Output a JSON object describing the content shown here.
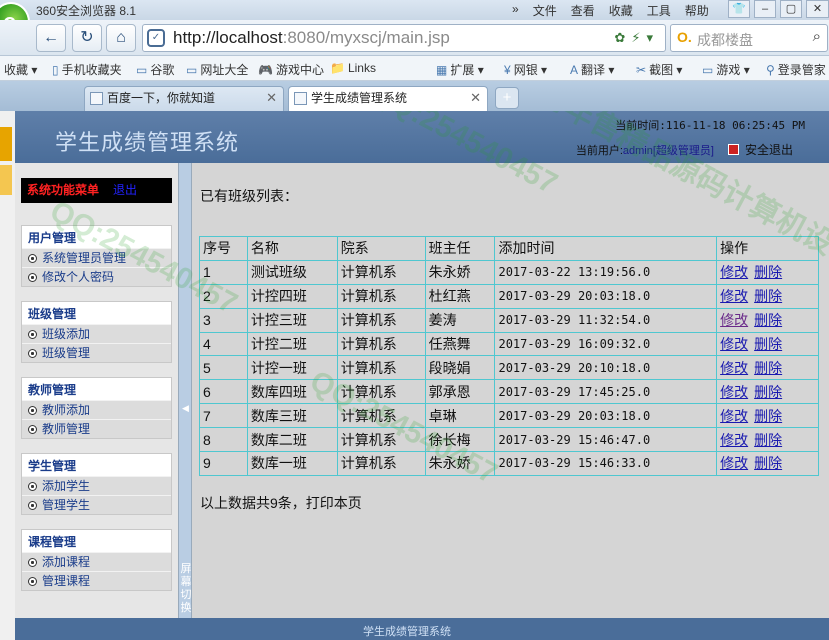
{
  "browser": {
    "app_title": "360安全浏览器 8.1",
    "menu": [
      "»",
      "文件",
      "查看",
      "收藏",
      "工具",
      "帮助"
    ],
    "url_host": "http://localhost",
    "url_path": ":8080/myxscj/main.jsp",
    "search_placeholder": "成都楼盘",
    "favorites": [
      "收藏",
      "手机收藏夹",
      "谷歌",
      "网址大全",
      "游戏中心",
      "Links",
      "扩展",
      "网银",
      "翻译",
      "截图",
      "游戏",
      "登录管家"
    ],
    "tabs": [
      {
        "label": "百度一下，你就知道"
      },
      {
        "label": "学生成绩管理系统"
      }
    ]
  },
  "header": {
    "system_title": "学生成绩管理系统",
    "current_time": "当前时间:116-11-18 06:25:45 PM",
    "user_prefix": "当前用户:",
    "user_name": "admin[超级管理员]",
    "logout_label": "安全退出"
  },
  "sidebar": {
    "top_menu_label": "系统功能菜单",
    "top_exit_label": "退出",
    "groups": [
      {
        "title": "用户管理",
        "items": [
          "系统管理员管理",
          "修改个人密码"
        ]
      },
      {
        "title": "班级管理",
        "items": [
          "班级添加",
          "班级管理"
        ]
      },
      {
        "title": "教师管理",
        "items": [
          "教师添加",
          "教师管理"
        ]
      },
      {
        "title": "学生管理",
        "items": [
          "添加学生",
          "管理学生"
        ]
      },
      {
        "title": "课程管理",
        "items": [
          "添加课程",
          "管理课程"
        ]
      }
    ]
  },
  "splitter": {
    "label": "屏幕切换"
  },
  "main": {
    "caption": "已有班级列表：",
    "columns": [
      "序号",
      "名称",
      "院系",
      "班主任",
      "添加时间",
      "操作"
    ],
    "edit_label": "修改",
    "delete_label": "删除",
    "rows": [
      [
        "1",
        "测试班级",
        "计算机系",
        "朱永娇",
        "2017-03-22 13:19:56.0"
      ],
      [
        "2",
        "计控四班",
        "计算机系",
        "杜红燕",
        "2017-03-29 20:03:18.0"
      ],
      [
        "3",
        "计控三班",
        "计算机系",
        "姜涛",
        "2017-03-29 11:32:54.0"
      ],
      [
        "4",
        "计控二班",
        "计算机系",
        "任燕舞",
        "2017-03-29 16:09:32.0"
      ],
      [
        "5",
        "计控一班",
        "计算机系",
        "段晓娟",
        "2017-03-29 20:10:18.0"
      ],
      [
        "6",
        "数库四班",
        "计算机系",
        "郭承恩",
        "2017-03-29 17:45:25.0"
      ],
      [
        "7",
        "数库三班",
        "计算机系",
        "卓琳",
        "2017-03-29 20:03:18.0"
      ],
      [
        "8",
        "数库二班",
        "计算机系",
        "徐长梅",
        "2017-03-29 15:46:47.0"
      ],
      [
        "9",
        "数库一班",
        "计算机系",
        "朱永娇",
        "2017-03-29 15:46:33.0"
      ]
    ],
    "footnote": "以上数据共9条，打印本页"
  },
  "footer": {
    "label": "学生成绩管理系统"
  },
  "watermark": {
    "text": "QQ:254540457",
    "tagline": "常年售精品源码计算机设计"
  },
  "colors": {
    "header_bg": "#4a6d99",
    "table_border": "#4fc7d0",
    "link": "#1a1ab0",
    "menu_red": "#ff2222"
  }
}
